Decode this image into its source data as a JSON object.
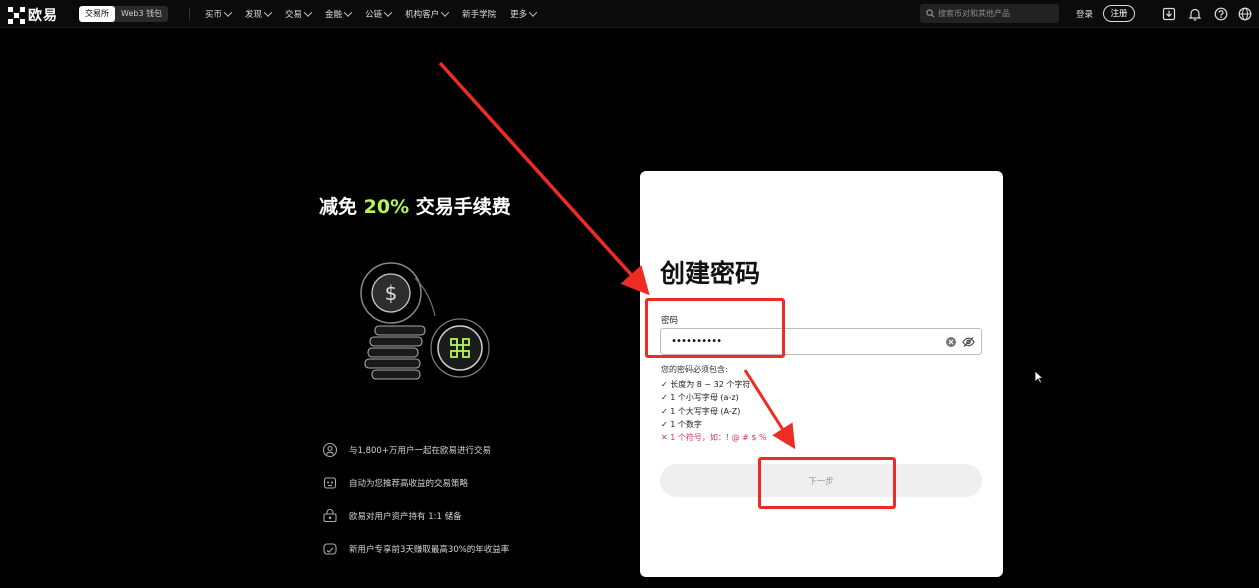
{
  "topbar": {
    "logo_text": "欧易",
    "segment": {
      "exchange": "交易所",
      "web3": "Web3 钱包"
    },
    "nav_items": [
      "买币",
      "发现",
      "交易",
      "金融",
      "公链",
      "机构客户",
      "新手学院",
      "更多"
    ],
    "nav_has_chevron": [
      true,
      true,
      true,
      true,
      true,
      true,
      false,
      true
    ],
    "search_placeholder": "搜索币对和其他产品",
    "login": "登录",
    "register": "注册",
    "icons": [
      "download-icon",
      "bell-icon",
      "help-icon",
      "globe-icon"
    ]
  },
  "promo": {
    "headline_prefix": "减免 ",
    "headline_accent": "20%",
    "headline_suffix": " 交易手续费",
    "accent_color": "#b6f558",
    "features": [
      {
        "icon": "users-globe-icon",
        "text": "与1,800+万用户一起在欧易进行交易"
      },
      {
        "icon": "robot-strategy-icon",
        "text": "自动为您推荐高收益的交易策略"
      },
      {
        "icon": "reserve-icon",
        "text": "欧易对用户资产持有 1:1 储备"
      },
      {
        "icon": "gift-icon",
        "text": "新用户专享前3天赚取最高30%的年收益率"
      }
    ]
  },
  "card": {
    "title": "创建密码",
    "password_label": "密码",
    "password_value": "••••••••••",
    "requirements_title": "您的密码必须包含:",
    "requirements": [
      {
        "ok": true,
        "mark": "✓",
        "text": "长度为 8 ~ 32 个字符"
      },
      {
        "ok": true,
        "mark": "✓",
        "text": "1 个小写字母 (a-z)"
      },
      {
        "ok": true,
        "mark": "✓",
        "text": "1 个大写字母 (A-Z)"
      },
      {
        "ok": true,
        "mark": "✓",
        "text": "1 个数字"
      },
      {
        "ok": false,
        "mark": "✕",
        "text": "1 个符号，如：! @ # $ %"
      }
    ],
    "next_button": "下一步"
  },
  "annotations": {
    "color": "#ee2b24"
  }
}
